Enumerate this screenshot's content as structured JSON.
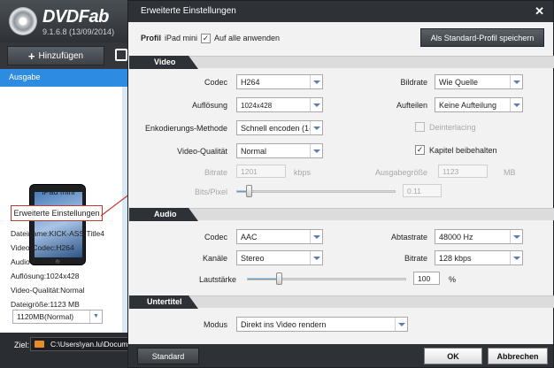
{
  "app": {
    "logo_text": "DVDFab",
    "version": "9.1.6.8 (13/09/2014)",
    "add_button": "Hinzufügen",
    "output_label": "Ausgabe",
    "device_name": "iPad mini",
    "advanced_settings_button": "Erweiterte Einstellungen",
    "info": [
      "Dateiname:KICK-ASS.Title4",
      "Video-Codec:H264",
      "Audio-Codec:AAC",
      "Auflösung:1024x428",
      "Video-Qualität:Normal",
      "Dateigröße:1123 MB"
    ],
    "size_select": "1120MB(Normal)",
    "target_label": "Ziel:",
    "target_path": "C:\\Users\\yan.lu\\Docum"
  },
  "dialog": {
    "title": "Erweiterte Einstellungen",
    "close_glyph": "✕",
    "profile_label": "Profil",
    "profile_value": "iPad mini",
    "apply_all_label": "Auf alle anwenden",
    "apply_all_checked": true,
    "save_default_button": "Als Standard-Profil speichern",
    "video": {
      "section_label": "Video",
      "codec_label": "Codec",
      "codec_value": "H264",
      "framerate_label": "Bildrate",
      "framerate_value": "Wie Quelle",
      "resolution_label": "Auflösung",
      "resolution_value": "1024x428",
      "split_label": "Aufteilen",
      "split_value": "Keine Aufteilung",
      "encoding_label": "Enkodierungs-Methode",
      "encoding_value": "Schnell encoden (1-p",
      "deinterlacing_label": "Deinterlacing",
      "deinterlacing_checked": false,
      "quality_label": "Video-Qualität",
      "quality_value": "Normal",
      "keep_chapters_label": "Kapitel beibehalten",
      "keep_chapters_checked": true,
      "bitrate_label": "Bitrate",
      "bitrate_value": "1201",
      "bitrate_unit": "kbps",
      "output_size_label": "Ausgabegröße",
      "output_size_value": "1123",
      "output_size_unit": "MB",
      "bits_pixel_label": "Bits/Pixel",
      "bits_pixel_value": "0.11",
      "bits_pixel_level": 0.08
    },
    "audio": {
      "section_label": "Audio",
      "codec_label": "Codec",
      "codec_value": "AAC",
      "samplerate_label": "Abtastrate",
      "samplerate_value": "48000 Hz",
      "channels_label": "Kanäle",
      "channels_value": "Stereo",
      "bitrate_label": "Bitrate",
      "bitrate_value": "128 kbps",
      "volume_label": "Lautstärke",
      "volume_value": "100",
      "volume_unit": "%",
      "volume_level": 0.2
    },
    "subtitle": {
      "section_label": "Untertitel",
      "mode_label": "Modus",
      "mode_value": "Direkt ins Video rendern"
    },
    "footer": {
      "standard_button": "Standard",
      "ok_button": "OK",
      "cancel_button": "Abbrechen"
    }
  },
  "colors": {
    "accent_blue": "#2d8be0",
    "annotation_red": "#c8382e",
    "title_bar": "#2e3236"
  }
}
